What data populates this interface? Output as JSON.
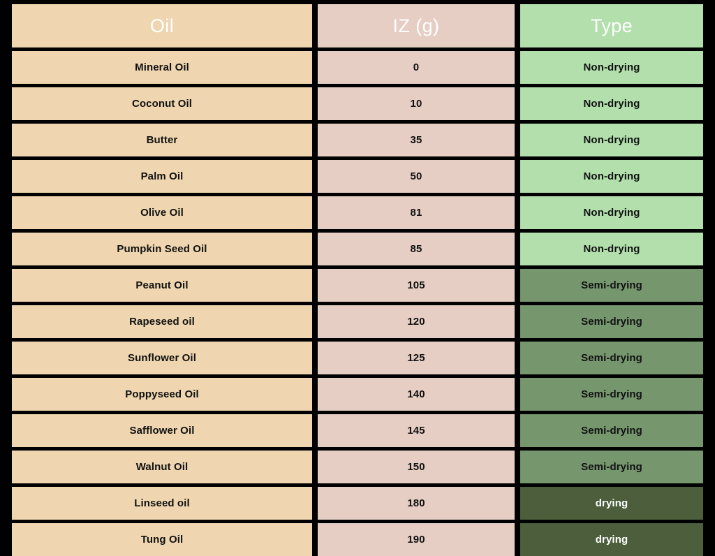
{
  "table": {
    "columns": [
      {
        "key": "oil",
        "label": "Oil",
        "header_bg": "#EFD6B0",
        "cell_bg": "#EFD6B0"
      },
      {
        "key": "iz",
        "label": "IZ (g)",
        "header_bg": "#E6CEC4",
        "cell_bg": "#E6CEC4"
      },
      {
        "key": "type",
        "label": "Type",
        "header_bg": "#B2DFAC",
        "cell_bg": "#B2DFAC"
      }
    ],
    "type_colors": {
      "Non-drying": {
        "bg": "#B2DFAC",
        "text": "#111111"
      },
      "Semi-drying": {
        "bg": "#76966E",
        "text": "#111111"
      },
      "drying": {
        "bg": "#4C5E3C",
        "text": "#FFFFFF"
      }
    },
    "background": "#000000",
    "rows": [
      {
        "oil": "Mineral Oil",
        "iz": "0",
        "type": "Non-drying"
      },
      {
        "oil": "Coconut Oil",
        "iz": "10",
        "type": "Non-drying"
      },
      {
        "oil": "Butter",
        "iz": "35",
        "type": "Non-drying"
      },
      {
        "oil": "Palm Oil",
        "iz": "50",
        "type": "Non-drying"
      },
      {
        "oil": "Olive Oil",
        "iz": "81",
        "type": "Non-drying"
      },
      {
        "oil": "Pumpkin Seed Oil",
        "iz": "85",
        "type": "Non-drying"
      },
      {
        "oil": "Peanut Oil",
        "iz": "105",
        "type": "Semi-drying"
      },
      {
        "oil": "Rapeseed oil",
        "iz": "120",
        "type": "Semi-drying"
      },
      {
        "oil": "Sunflower Oil",
        "iz": "125",
        "type": "Semi-drying"
      },
      {
        "oil": "Poppyseed Oil",
        "iz": "140",
        "type": "Semi-drying"
      },
      {
        "oil": "Safflower Oil",
        "iz": "145",
        "type": "Semi-drying"
      },
      {
        "oil": "Walnut Oil",
        "iz": "150",
        "type": "Semi-drying"
      },
      {
        "oil": "Linseed oil",
        "iz": "180",
        "type": "drying"
      },
      {
        "oil": "Tung Oil",
        "iz": "190",
        "type": "drying"
      }
    ]
  }
}
